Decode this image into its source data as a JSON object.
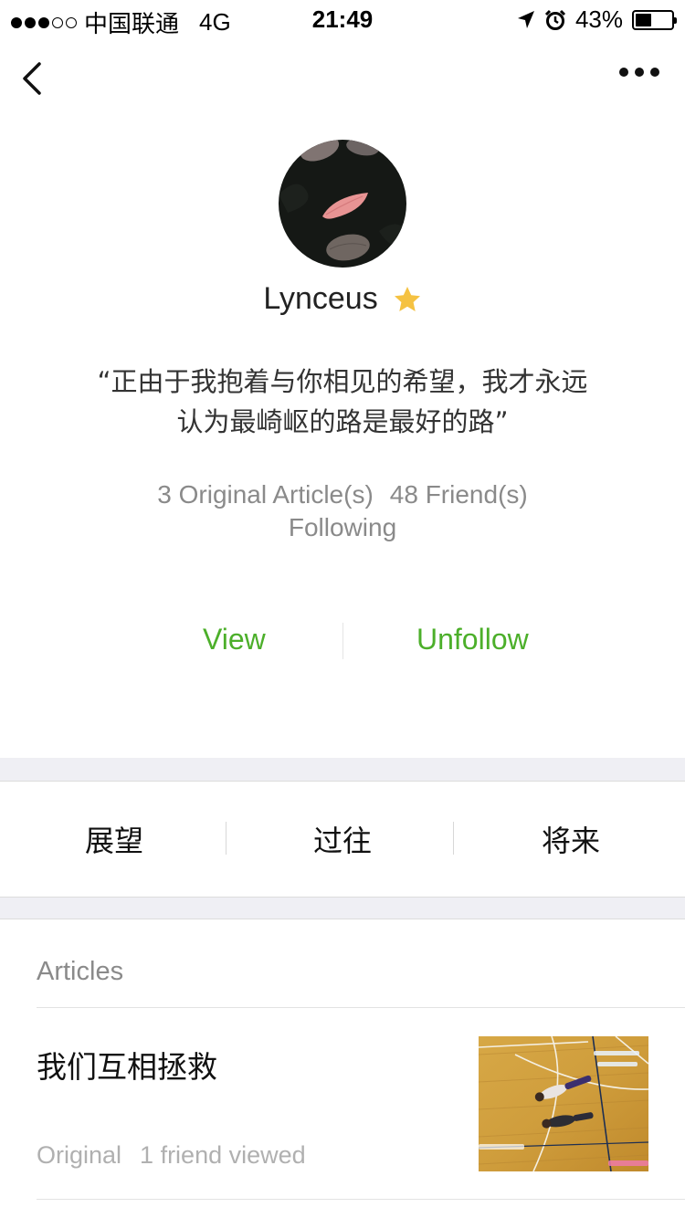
{
  "status_bar": {
    "carrier": "中国联通",
    "network": "4G",
    "time": "21:49",
    "battery": "43%",
    "battery_level": 0.43,
    "signal_strength": 3
  },
  "nav": {
    "back_icon": "chevron-left-icon",
    "more_icon": "more-dots-icon"
  },
  "profile": {
    "name": "Lynceus",
    "badge_icon": "star-icon",
    "quote": "“正由于我抱着与你相见的希望，我才永远认为最崎岖的路是最好的路”",
    "original_articles": "3 Original Article(s)",
    "friends_following_count": "48 Friend(s)",
    "friends_following_label": "Following"
  },
  "actions": {
    "view": "View",
    "unfollow": "Unfollow"
  },
  "menu": [
    "展望",
    "过往",
    "将来"
  ],
  "articles": {
    "section_title": "Articles",
    "items": [
      {
        "title": "我们互相拯救",
        "tag": "Original",
        "views": "1 friend viewed"
      }
    ]
  },
  "colors": {
    "accent_green": "#4caf2a",
    "separator_gray": "#efeff4",
    "star_gold": "#f5c242"
  }
}
